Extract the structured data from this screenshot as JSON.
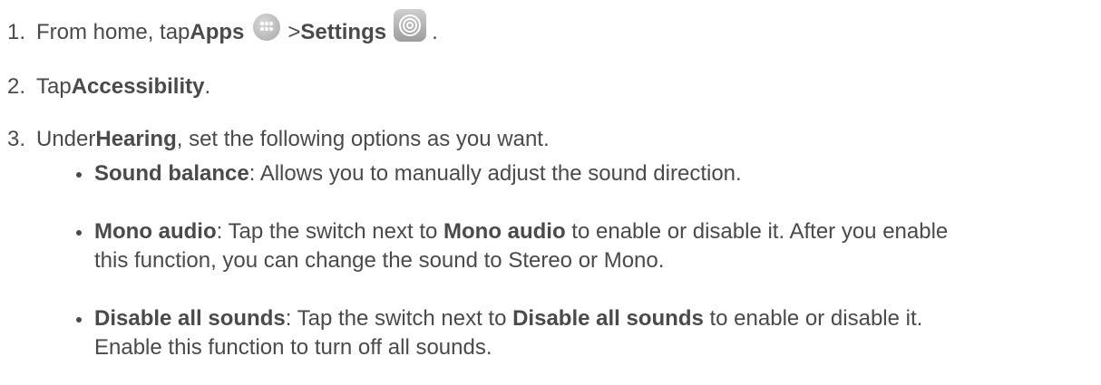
{
  "steps": [
    {
      "number": "1.",
      "prefix": "From home, tap ",
      "bold1": "Apps",
      "icon1": "apps-grid-icon",
      "mid": " > ",
      "bold2": "Settings",
      "icon2": "settings-gear-icon",
      "suffix": " ."
    },
    {
      "number": "2.",
      "prefix": "Tap ",
      "bold1": "Accessibility",
      "suffix": "."
    },
    {
      "number": "3.",
      "prefix": "Under ",
      "bold1": "Hearing",
      "suffix": ", set the following options as you want."
    }
  ],
  "bullets": [
    {
      "title": "Sound balance",
      "text_line1": ": Allows you to manually adjust the sound direction."
    },
    {
      "title": "Mono audio",
      "text_before_bold": ": Tap the switch next to ",
      "bold_inline": "Mono audio",
      "text_line1_after": " to enable or disable it. After you enable",
      "line2": "this function, you can change the sound to Stereo or Mono."
    },
    {
      "title": "Disable all sounds",
      "text_before_bold": ": Tap the switch next to ",
      "bold_inline": "Disable all sounds",
      "text_line1_after": " to enable or disable it.",
      "line2": "Enable this function to turn off all sounds."
    }
  ]
}
